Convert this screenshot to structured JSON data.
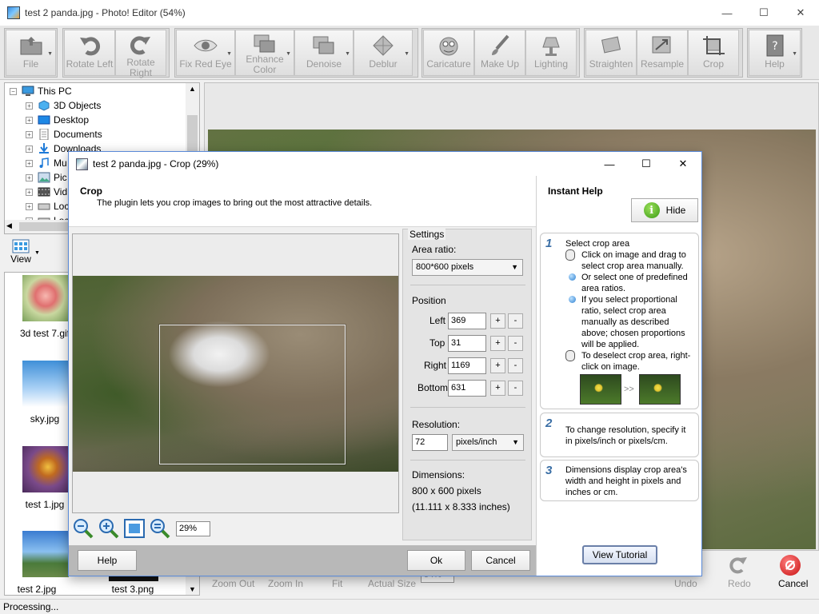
{
  "window": {
    "title": "test 2 panda.jpg - Photo! Editor (54%)"
  },
  "toolbar": {
    "file": "File",
    "rotate_left": "Rotate Left",
    "rotate_right": "Rotate Right",
    "fix_red_eye": "Fix Red Eye",
    "enhance_color": "Enhance\nColor",
    "denoise": "Denoise",
    "deblur": "Deblur",
    "caricature": "Caricature",
    "make_up": "Make Up",
    "lighting": "Lighting",
    "straighten": "Straighten",
    "resample": "Resample",
    "crop": "Crop",
    "help": "Help"
  },
  "tree": {
    "root": "This PC",
    "items": [
      "3D Objects",
      "Desktop",
      "Documents",
      "Downloads",
      "Mu",
      "Pic",
      "Vid",
      "Loc",
      "Loc"
    ]
  },
  "view_bar": {
    "label": "View"
  },
  "thumbnails": [
    {
      "label": "3d test 7.gif"
    },
    {
      "label": "sky.jpg"
    },
    {
      "label": "test 1.jpg"
    },
    {
      "label": "test 2.jpg"
    },
    {
      "label": "test 3.png"
    }
  ],
  "bottom_bar": {
    "zoom_out": "Zoom Out",
    "zoom_in": "Zoom In",
    "fit": "Fit",
    "actual_size": "Actual Size",
    "zoom_value": "54%",
    "undo": "Undo",
    "redo": "Redo",
    "cancel": "Cancel"
  },
  "status": {
    "text": "Processing..."
  },
  "dialog": {
    "title": "test 2 panda.jpg - Crop (29%)",
    "header_title": "Crop",
    "header_desc": "The plugin lets you crop images to bring out the most attractive details.",
    "zoom_value": "29%",
    "settings": {
      "heading": "Settings",
      "area_ratio_label": "Area ratio:",
      "area_ratio_value": "800*600 pixels",
      "position_label": "Position",
      "left_label": "Left",
      "left_value": "369",
      "top_label": "Top",
      "top_value": "31",
      "right_label": "Right",
      "right_value": "1169",
      "bottom_label": "Bottom",
      "bottom_value": "631",
      "plus": "+",
      "minus": "-",
      "resolution_label": "Resolution:",
      "resolution_value": "72",
      "resolution_unit": "pixels/inch",
      "dimensions_label": "Dimensions:",
      "dimensions_pixels": "800 x 600 pixels",
      "dimensions_inches": "(11.111 x 8.333 inches)"
    },
    "buttons": {
      "help": "Help",
      "ok": "Ok",
      "cancel": "Cancel"
    },
    "instant_help": {
      "title": "Instant Help",
      "hide": "Hide",
      "step1_num": "1",
      "step1_title": "Select crop area",
      "step1_b1": "Click on image and drag to select crop area manually.",
      "step1_b2": "Or select one of predefined area ratios.",
      "step1_b3": "If you select proportional ratio, select crop area manually as described above; chosen proportions will be applied.",
      "step1_b4": "To deselect crop area, right-click on image.",
      "step1_arrow": ">>",
      "step2_num": "2",
      "step2_text": "To change resolution, specify it in pixels/inch or pixels/cm.",
      "step3_num": "3",
      "step3_text": "Dimensions display crop area's width and height in pixels and inches or cm.",
      "view_tutorial": "View Tutorial"
    }
  },
  "colors": {
    "accent": "#3a6ea5",
    "dialog_border": "#5a8ad8",
    "footer": "#b8b8b8"
  }
}
